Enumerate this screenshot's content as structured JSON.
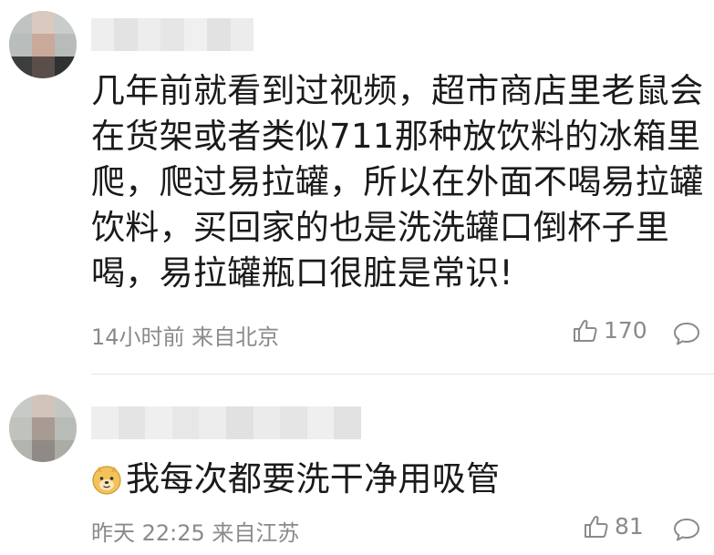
{
  "comments": [
    {
      "avatar_icon": "blurred-avatar",
      "content_lines": [
        "几年前就看到过视频，超市商店里老鼠会",
        "在货架或者类似711那种放饮料的冰箱里",
        "爬，爬过易拉罐，所以在外面不喝易拉罐",
        "饮料，买回家的也是洗洗罐口倒杯子里",
        "喝，易拉罐瓶口很脏是常识!"
      ],
      "meta": "14小时前 来自北京",
      "likes": "170",
      "like_icon": "thumbs-up-icon",
      "reply_icon": "comment-bubble-icon"
    },
    {
      "avatar_icon": "blurred-avatar",
      "emoji_icon": "doge-emoji",
      "content": "我每次都要洗干净用吸管",
      "meta": "昨天 22:25 来自江苏",
      "likes": "81",
      "like_icon": "thumbs-up-icon",
      "reply_icon": "comment-bubble-icon"
    }
  ],
  "colors": {
    "text": "#1a1a1a",
    "meta": "#8a8a8a",
    "divider": "#e6e6e6"
  }
}
